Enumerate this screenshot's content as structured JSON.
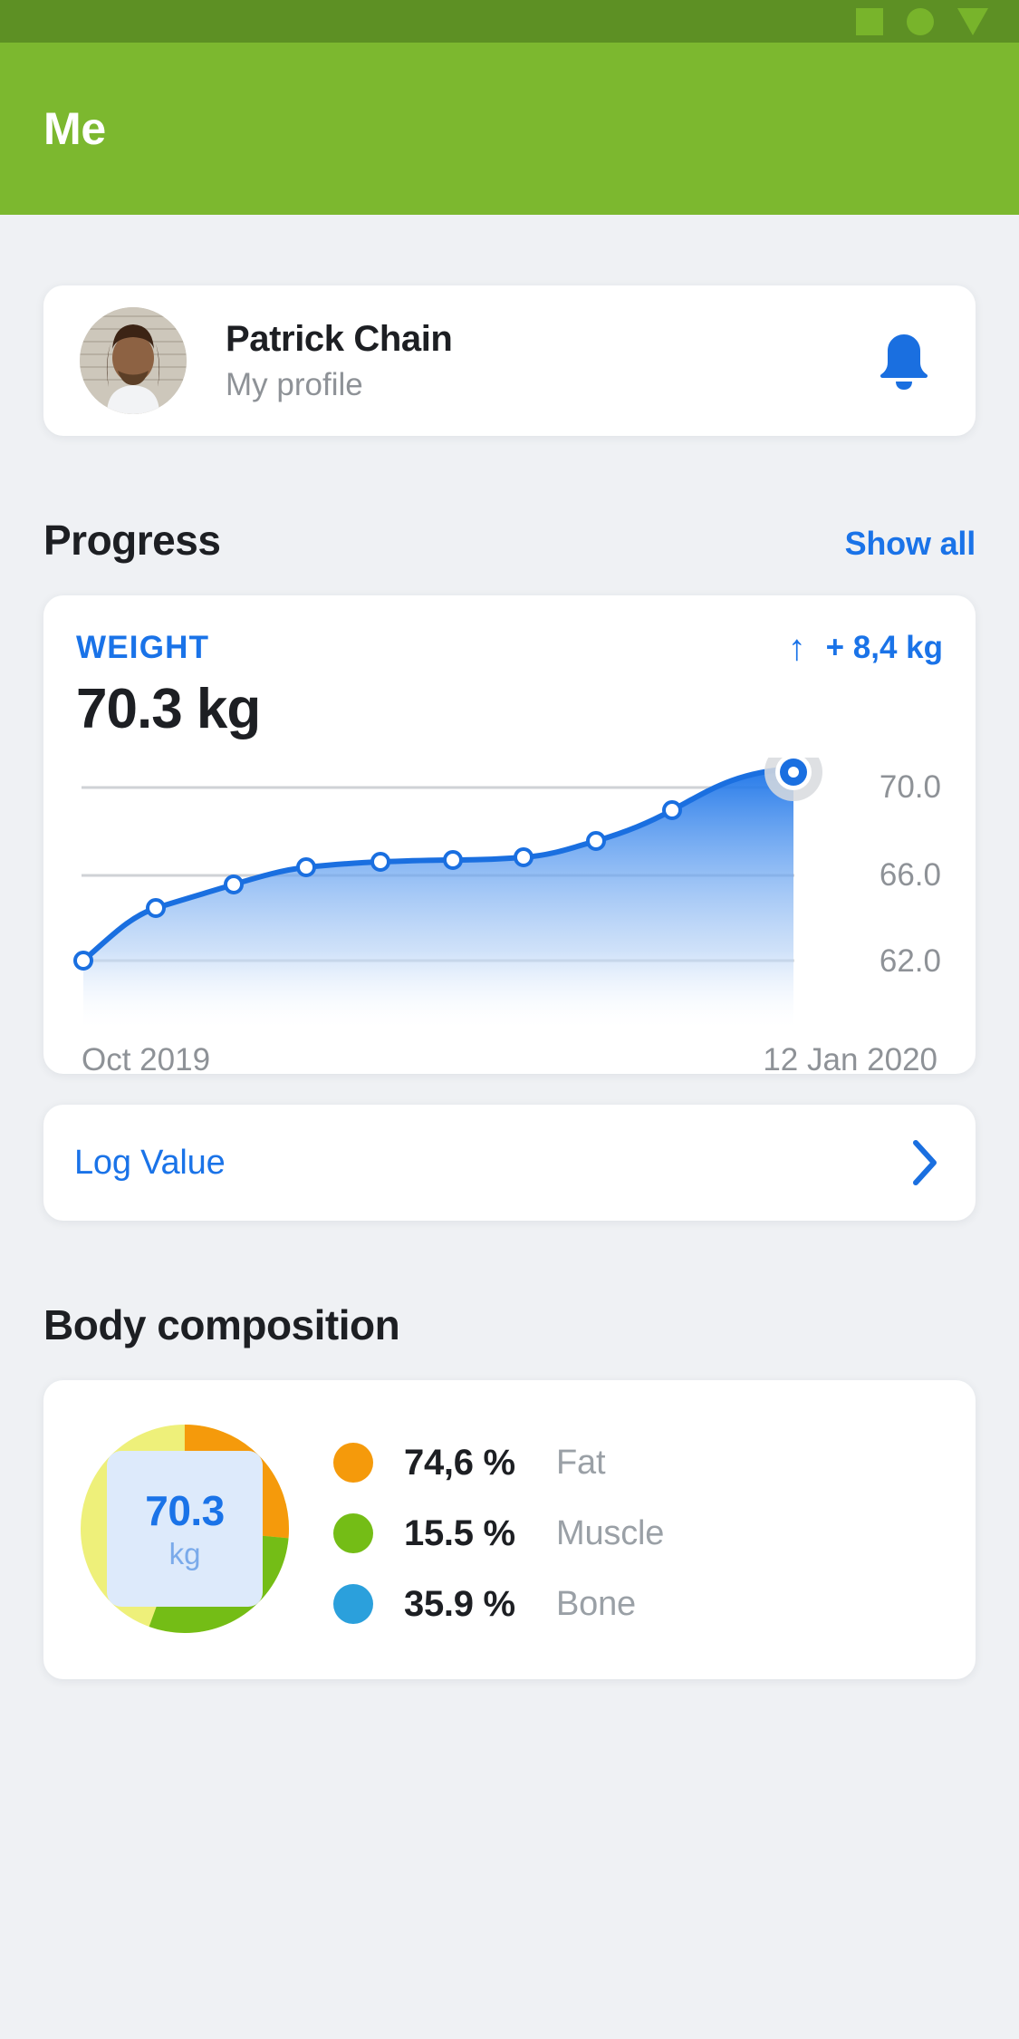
{
  "status_bar": {
    "nav_buttons": [
      "square-nav-icon",
      "circle-nav-icon",
      "triangle-nav-icon"
    ],
    "background": "#5d9024"
  },
  "appbar": {
    "title": "Me",
    "background": "#7cb82f"
  },
  "profile": {
    "name": "Patrick Chain",
    "subtitle": "My profile",
    "avatar_icon": "user-photo",
    "bell_icon": "notification-bell-icon",
    "bell_color": "#1a73e8"
  },
  "progress_section": {
    "title": "Progress",
    "show_all_label": "Show all",
    "link_color": "#1a73e8"
  },
  "weight_card": {
    "label": "WEIGHT",
    "delta_arrow": "↑",
    "delta": "+ 8,4 kg",
    "value": "70.3 kg",
    "accent": "#1a73e8",
    "start_date": "Oct 2019",
    "end_date": "12 Jan 2020"
  },
  "log_row": {
    "label": "Log Value",
    "chevron_icon": "chevron-right-icon",
    "color": "#1a73e8"
  },
  "body_composition": {
    "title": "Body composition",
    "center_value": "70.3",
    "center_unit": "kg",
    "legend": [
      {
        "percent": "74,6 %",
        "name": "Fat",
        "color": "#f59a0b"
      },
      {
        "percent": "15.5 %",
        "name": "Muscle",
        "color": "#74bd16"
      },
      {
        "percent": "35.9 %",
        "name": "Bone",
        "color": "#2ba0dc"
      }
    ]
  },
  "chart_data": [
    {
      "type": "area",
      "title": "WEIGHT",
      "xlabel": "",
      "ylabel": "kg",
      "ylim": [
        60.0,
        71.5
      ],
      "yticks": [
        "70.0",
        "66.0",
        "62.0"
      ],
      "ytick_values": [
        70.0,
        66.0,
        62.0
      ],
      "grid": true,
      "legend": "none",
      "x": [
        "Oct 2019",
        "",
        "",
        "",
        "",
        "",
        "",
        "",
        "",
        "12 Jan 2020"
      ],
      "values": [
        62.0,
        64.5,
        65.8,
        66.4,
        66.7,
        66.9,
        67.0,
        67.6,
        68.6,
        70.3
      ],
      "line_color": "#1a73e8",
      "fill": "gradient-blue",
      "marker": "white-circle",
      "highlight_last": true,
      "xtick_labels": [
        "Oct 2019",
        "12 Jan 2020"
      ]
    },
    {
      "type": "pie",
      "title": "Body composition",
      "categories": [
        "Fat",
        "Muscle",
        "Bone"
      ],
      "labels": [
        "74,6 %",
        "15.5 %",
        "35.9 %"
      ],
      "values": [
        74.6,
        15.5,
        35.9
      ],
      "colors": [
        "#f59a0b",
        "#74bd16",
        "#eef07a"
      ],
      "donut": true,
      "center_text": "70.3 kg",
      "legend": "right"
    }
  ]
}
